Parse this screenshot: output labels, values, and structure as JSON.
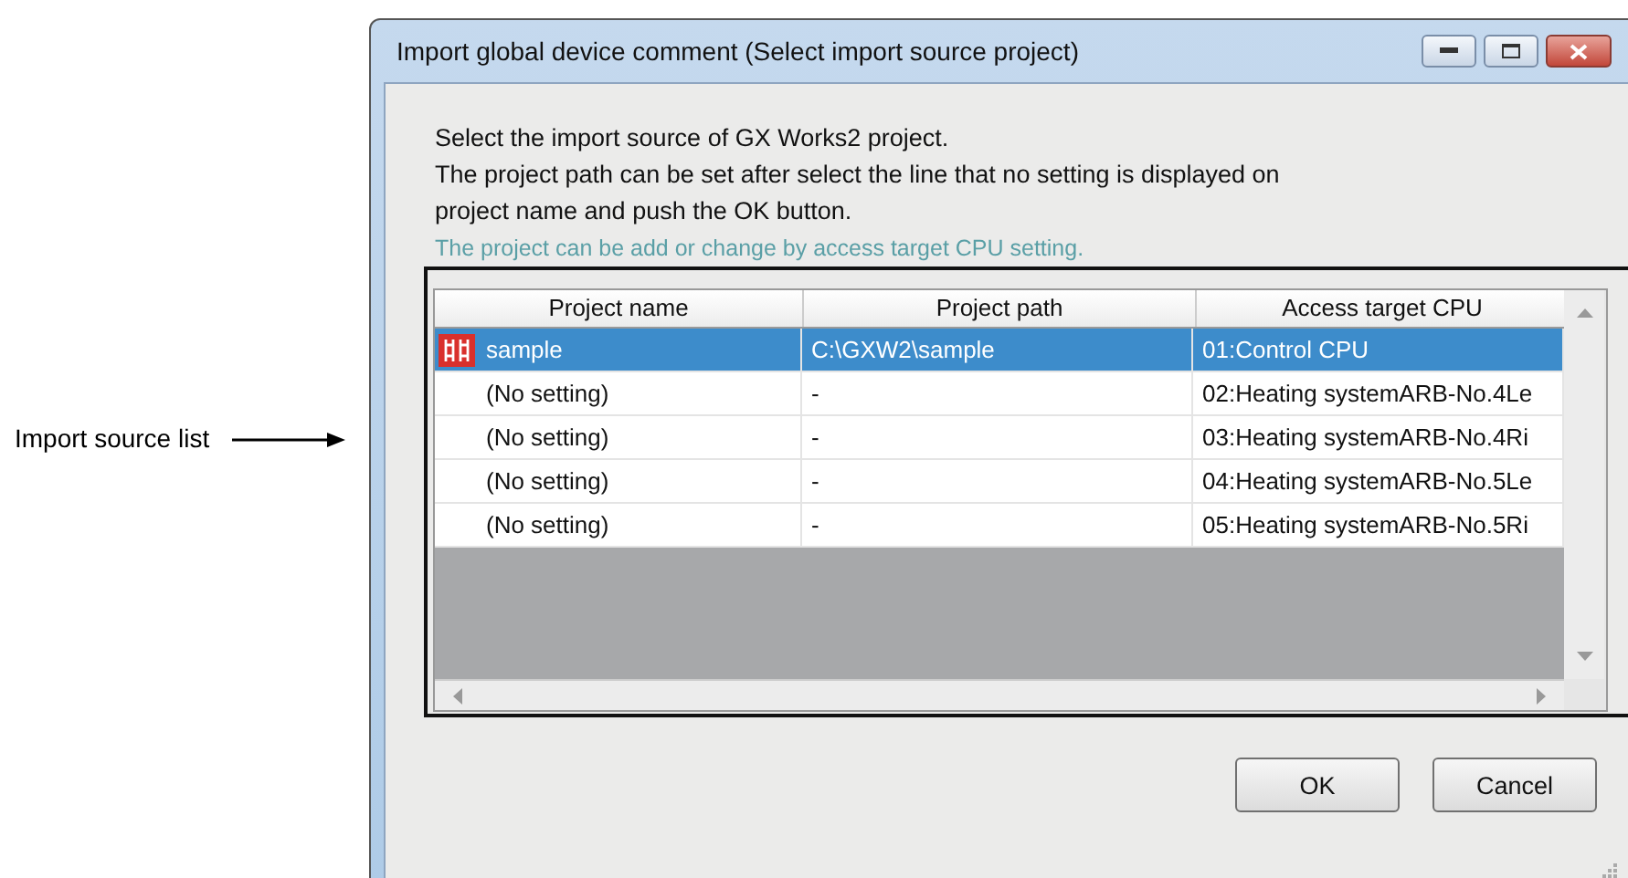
{
  "annotation": {
    "label": "Import source list"
  },
  "window": {
    "title": "Import global device comment (Select import source project)"
  },
  "message": [
    "Select the import source of GX Works2 project.",
    "The project path can be set after select the line that no setting is displayed on",
    "project name and push the OK button."
  ],
  "note": "The project can be add or change by access target CPU setting.",
  "table": {
    "columns": [
      "Project name",
      "Project path",
      "Access target CPU"
    ],
    "rows": [
      {
        "kind": "project",
        "selected": true,
        "cells": [
          "sample",
          "C:\\GXW2\\sample",
          "01:Control CPU"
        ]
      },
      {
        "kind": "empty",
        "selected": false,
        "cells": [
          "(No setting)",
          "-",
          "02:Heating systemARB-No.4Le"
        ]
      },
      {
        "kind": "empty",
        "selected": false,
        "cells": [
          "(No setting)",
          "-",
          "03:Heating systemARB-No.4Ri"
        ]
      },
      {
        "kind": "empty",
        "selected": false,
        "cells": [
          "(No setting)",
          "-",
          "04:Heating systemARB-No.5Le"
        ]
      },
      {
        "kind": "empty",
        "selected": false,
        "cells": [
          "(No setting)",
          "-",
          "05:Heating systemARB-No.5Ri"
        ]
      }
    ]
  },
  "buttons": [
    "OK",
    "Cancel"
  ]
}
